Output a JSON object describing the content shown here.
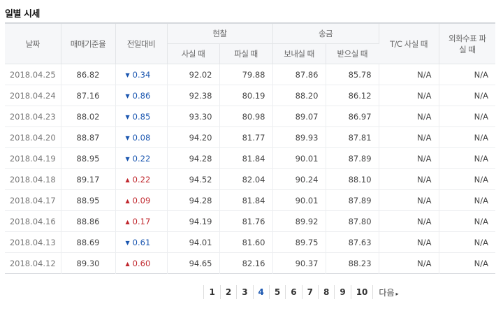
{
  "section_title": "일별 시세",
  "headers": {
    "date": "날짜",
    "base_rate": "매매기준율",
    "change": "전일대비",
    "cash": "현찰",
    "cash_buy": "사실 때",
    "cash_sell": "파실 때",
    "transfer": "송금",
    "transfer_send": "보내실 때",
    "transfer_receive": "받으실 때",
    "tc_buy": "T/C 사실 때",
    "foreign_check_sell": "외화수표 파실 때"
  },
  "colors": {
    "down": "#1a56b0",
    "up": "#c0272d"
  },
  "rows": [
    {
      "date": "2018.04.25",
      "base": "86.82",
      "dir": "down",
      "change": "0.34",
      "cash_buy": "92.02",
      "cash_sell": "79.88",
      "send": "87.86",
      "receive": "85.78",
      "tc": "N/A",
      "check": "N/A"
    },
    {
      "date": "2018.04.24",
      "base": "87.16",
      "dir": "down",
      "change": "0.86",
      "cash_buy": "92.38",
      "cash_sell": "80.19",
      "send": "88.20",
      "receive": "86.12",
      "tc": "N/A",
      "check": "N/A"
    },
    {
      "date": "2018.04.23",
      "base": "88.02",
      "dir": "down",
      "change": "0.85",
      "cash_buy": "93.30",
      "cash_sell": "80.98",
      "send": "89.07",
      "receive": "86.97",
      "tc": "N/A",
      "check": "N/A"
    },
    {
      "date": "2018.04.20",
      "base": "88.87",
      "dir": "down",
      "change": "0.08",
      "cash_buy": "94.20",
      "cash_sell": "81.77",
      "send": "89.93",
      "receive": "87.81",
      "tc": "N/A",
      "check": "N/A"
    },
    {
      "date": "2018.04.19",
      "base": "88.95",
      "dir": "down",
      "change": "0.22",
      "cash_buy": "94.28",
      "cash_sell": "81.84",
      "send": "90.01",
      "receive": "87.89",
      "tc": "N/A",
      "check": "N/A"
    },
    {
      "date": "2018.04.18",
      "base": "89.17",
      "dir": "up",
      "change": "0.22",
      "cash_buy": "94.52",
      "cash_sell": "82.04",
      "send": "90.24",
      "receive": "88.10",
      "tc": "N/A",
      "check": "N/A"
    },
    {
      "date": "2018.04.17",
      "base": "88.95",
      "dir": "up",
      "change": "0.09",
      "cash_buy": "94.28",
      "cash_sell": "81.84",
      "send": "90.01",
      "receive": "87.89",
      "tc": "N/A",
      "check": "N/A"
    },
    {
      "date": "2018.04.16",
      "base": "88.86",
      "dir": "up",
      "change": "0.17",
      "cash_buy": "94.19",
      "cash_sell": "81.76",
      "send": "89.92",
      "receive": "87.80",
      "tc": "N/A",
      "check": "N/A"
    },
    {
      "date": "2018.04.13",
      "base": "88.69",
      "dir": "down",
      "change": "0.61",
      "cash_buy": "94.01",
      "cash_sell": "81.60",
      "send": "89.75",
      "receive": "87.63",
      "tc": "N/A",
      "check": "N/A"
    },
    {
      "date": "2018.04.12",
      "base": "89.30",
      "dir": "up",
      "change": "0.60",
      "cash_buy": "94.65",
      "cash_sell": "82.16",
      "send": "90.37",
      "receive": "88.23",
      "tc": "N/A",
      "check": "N/A"
    }
  ],
  "pagination": {
    "pages": [
      "1",
      "2",
      "3",
      "4",
      "5",
      "6",
      "7",
      "8",
      "9",
      "10"
    ],
    "current": "4",
    "next_label": "다음"
  }
}
